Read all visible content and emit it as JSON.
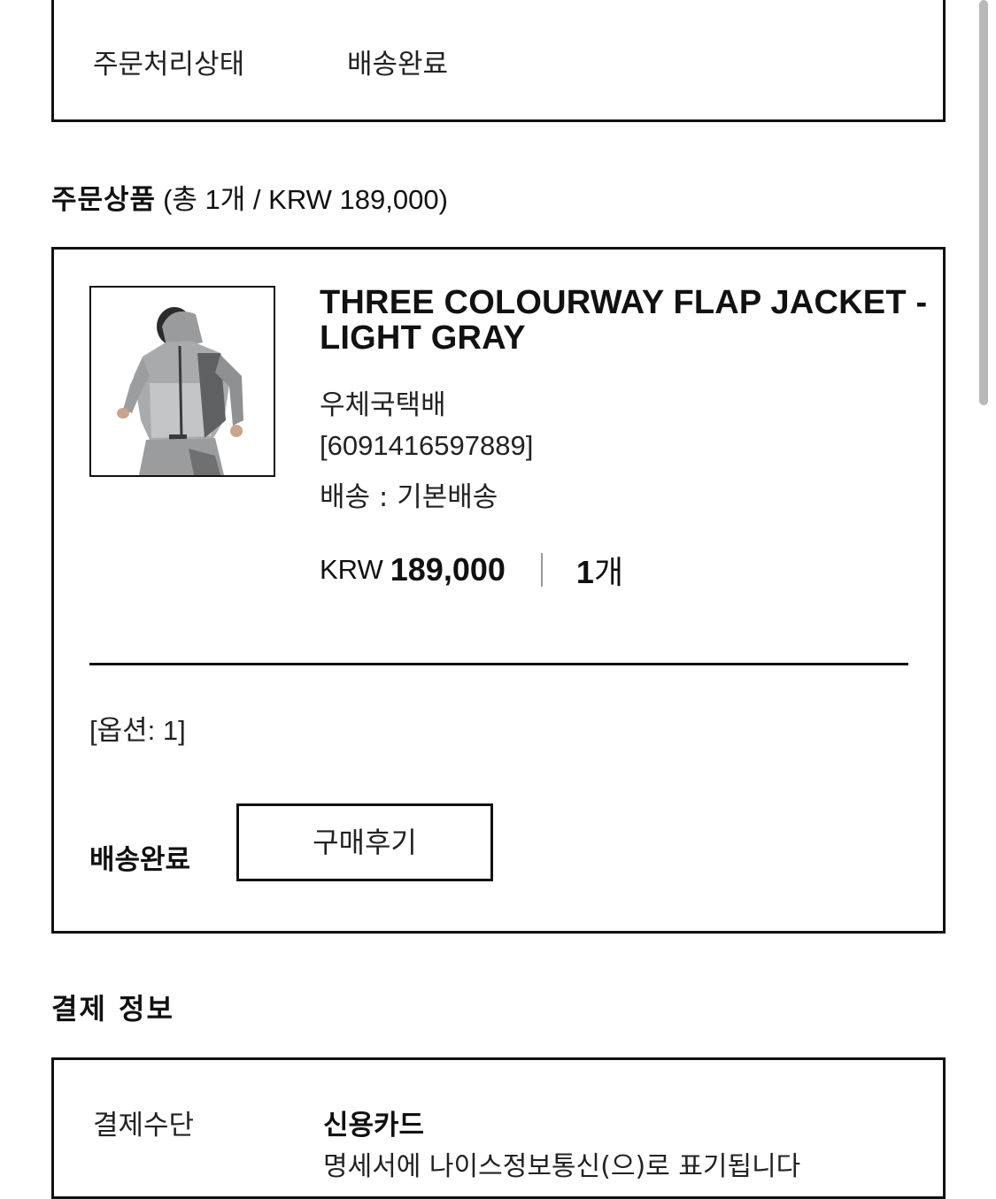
{
  "order_status": {
    "label": "주문처리상태",
    "value": "배송완료"
  },
  "products_section": {
    "title": "주문상품",
    "summary": "(총 1개 / KRW 189,000)"
  },
  "product": {
    "name": "THREE COLOURWAY FLAP JACKET - LIGHT GRAY",
    "carrier": "우체국택배",
    "tracking_number": "[6091416597889]",
    "shipping": "배송 : 기본배송",
    "currency": "KRW",
    "price": "189,000",
    "quantity_number": "1",
    "quantity_unit": "개",
    "option": "[옵션: 1]",
    "delivery_status": "배송완료",
    "review_button": "구매후기",
    "image_icon": "product-photo"
  },
  "payment": {
    "title": "결제 정보",
    "method_label": "결제수단",
    "method_value": "신용카드",
    "note": "명세서에 나이스정보통신(으)로 표기됩니다"
  },
  "colors": {
    "border": "#111111",
    "text": "#111111",
    "scrollbar": "#b9b9b9"
  }
}
